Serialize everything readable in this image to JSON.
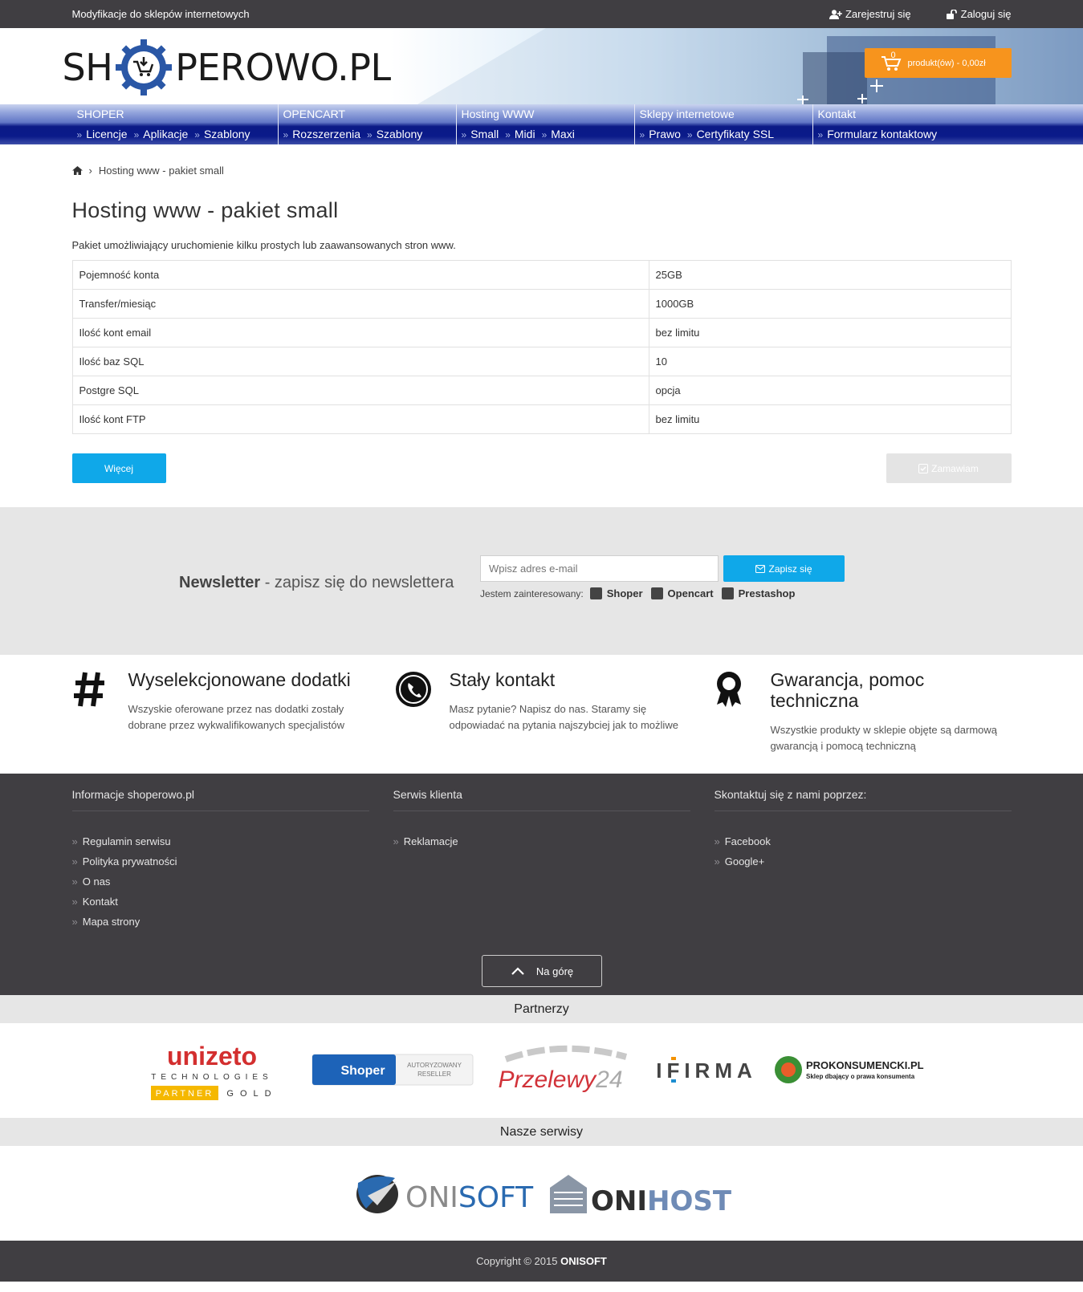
{
  "topbar": {
    "tagline": "Modyfikacje do sklepów internetowych",
    "register": "Zarejestruj się",
    "login": "Zaloguj się"
  },
  "header": {
    "logo_left": "SH",
    "logo_right": "PEROWO.PL",
    "cart_count": "0",
    "cart_label": "produkt(ów) - 0,00zł",
    "accent": "#f7941d"
  },
  "nav": [
    {
      "title": "SHOPER",
      "items": [
        "Licencje",
        "Aplikacje",
        "Szablony"
      ]
    },
    {
      "title": "OPENCART",
      "items": [
        "Rozszerzenia",
        "Szablony"
      ]
    },
    {
      "title": "Hosting WWW",
      "items": [
        "Small",
        "Midi",
        "Maxi"
      ]
    },
    {
      "title": "Sklepy internetowe",
      "items": [
        "Prawo",
        "Certyfikaty SSL"
      ]
    },
    {
      "title": "Kontakt",
      "items": [
        "Formularz kontaktowy"
      ]
    }
  ],
  "breadcrumb": {
    "current": "Hosting www - pakiet small"
  },
  "product": {
    "title": "Hosting www - pakiet small",
    "description": "Pakiet umożliwiający uruchomienie kilku prostych lub zaawansowanych stron www.",
    "specs": [
      [
        "Pojemność konta",
        "25GB"
      ],
      [
        "Transfer/miesiąc",
        "1000GB"
      ],
      [
        "Ilość kont email",
        "bez limitu"
      ],
      [
        "Ilość baz SQL",
        "10"
      ],
      [
        "Postgre SQL",
        "opcja"
      ],
      [
        "Ilość kont FTP",
        "bez limitu"
      ]
    ],
    "more_label": "Więcej",
    "order_label": "Zamawiam"
  },
  "newsletter": {
    "title_bold": "Newsletter",
    "title_rest": " - zapisz się do newslettera",
    "placeholder": "Wpisz adres e-mail",
    "button": "Zapisz się",
    "interest_label": "Jestem zainteresowany:",
    "options": [
      "Shoper",
      "Opencart",
      "Prestashop"
    ]
  },
  "features": [
    {
      "icon": "hash-icon",
      "title": "Wyselekcjonowane dodatki",
      "text": "Wszyskie oferowane przez nas dodatki zostały dobrane przez wykwalifikowanych specjalistów"
    },
    {
      "icon": "phone-icon",
      "title": "Stały kontakt",
      "text": "Masz pytanie? Napisz do nas. Staramy się odpowiadać na pytania najszybciej jak to możliwe"
    },
    {
      "icon": "award-icon",
      "title": "Gwarancja, pomoc techniczna",
      "text": "Wszystkie produkty w sklepie objęte są darmową gwarancją i pomocą techniczną"
    }
  ],
  "footer": {
    "col1": {
      "title": "Informacje shoperowo.pl",
      "links": [
        "Regulamin serwisu",
        "Polityka prywatności",
        "O nas",
        "Kontakt",
        "Mapa strony"
      ]
    },
    "col2": {
      "title": "Serwis klienta",
      "links": [
        "Reklamacje"
      ]
    },
    "col3": {
      "title": "Skontaktuj się z nami poprzez:",
      "links": [
        "Facebook",
        "Google+"
      ]
    },
    "to_top": "Na górę"
  },
  "partners": {
    "title": "Partnerzy",
    "unizeto": {
      "name": "unizeto",
      "sub": "TECHNOLOGIES",
      "badge": "PARTNER",
      "level": "GOLD"
    },
    "shoper": {
      "name": "Shoper",
      "sub1": "AUTORYZOWANY",
      "sub2": "RESELLER"
    },
    "przelewy": {
      "name": "Przelewy",
      "num": "24"
    },
    "ifirma": {
      "name": "IFIRMA"
    },
    "prokonsumencki": {
      "name": "PROKONSUMENCKI.PL",
      "sub": "Sklep dbający o prawa konsumenta"
    }
  },
  "services": {
    "title": "Nasze serwisy",
    "onisoft": {
      "a": "ONI",
      "b": "SOFT"
    },
    "onihost": {
      "a": "ONI",
      "b": "HOST"
    }
  },
  "copyright": {
    "text": "Copyright © 2015 ",
    "brand": "ONISOFT"
  }
}
